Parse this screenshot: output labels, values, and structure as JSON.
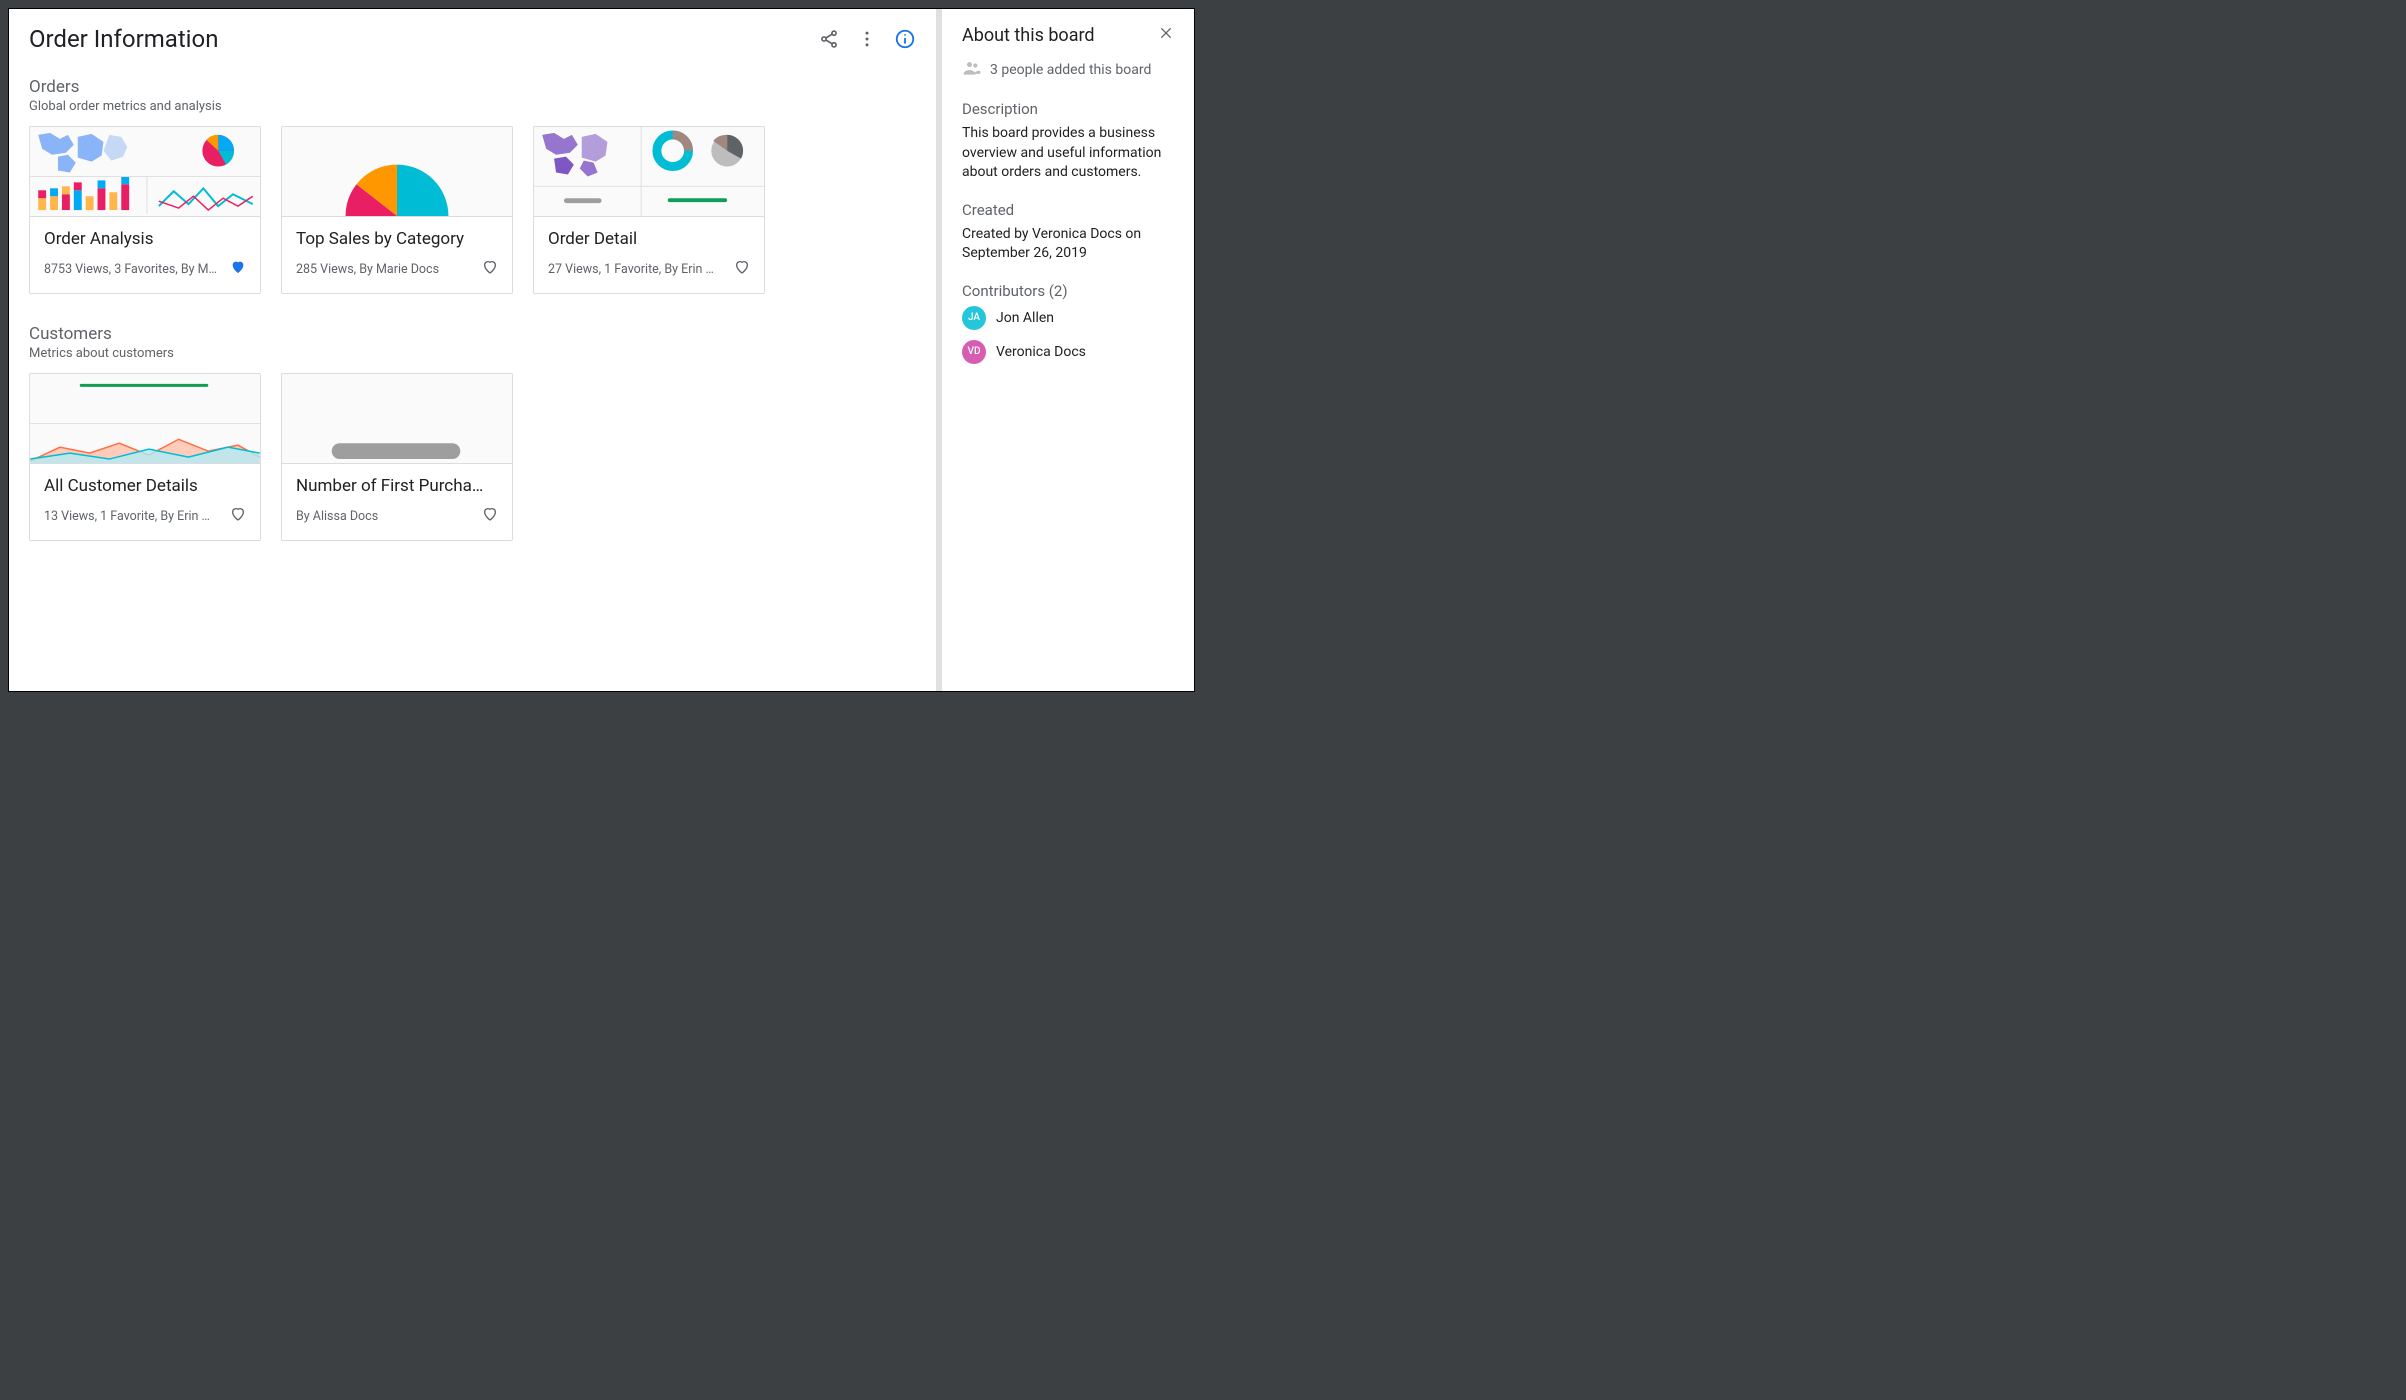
{
  "header": {
    "title": "Order Information"
  },
  "sections": [
    {
      "title": "Orders",
      "subtitle": "Global order metrics and analysis",
      "cards": [
        {
          "title": "Order Analysis",
          "meta": "8753 Views, 3 Favorites, By M…",
          "favorited": true
        },
        {
          "title": "Top Sales by Category",
          "meta": "285 Views, By Marie Docs",
          "favorited": false
        },
        {
          "title": "Order Detail",
          "meta": "27 Views, 1 Favorite, By Erin …",
          "favorited": false
        }
      ]
    },
    {
      "title": "Customers",
      "subtitle": "Metrics about customers",
      "cards": [
        {
          "title": "All Customer Details",
          "meta": "13 Views, 1 Favorite, By Erin …",
          "favorited": false
        },
        {
          "title": "Number of First Purcha…",
          "meta": "By Alissa Docs",
          "favorited": false
        }
      ]
    }
  ],
  "side": {
    "title": "About this board",
    "people_added": "3 people added this board",
    "description_label": "Description",
    "description_text": "This board provides a business overview and useful information about orders and customers.",
    "created_label": "Created",
    "created_text": "Created by Veronica Docs on September 26, 2019",
    "contributors_label": "Contributors (2)",
    "contributors": [
      {
        "initials": "JA",
        "name": "Jon Allen",
        "color": "teal"
      },
      {
        "initials": "VD",
        "name": "Veronica Docs",
        "color": "pink"
      }
    ]
  }
}
